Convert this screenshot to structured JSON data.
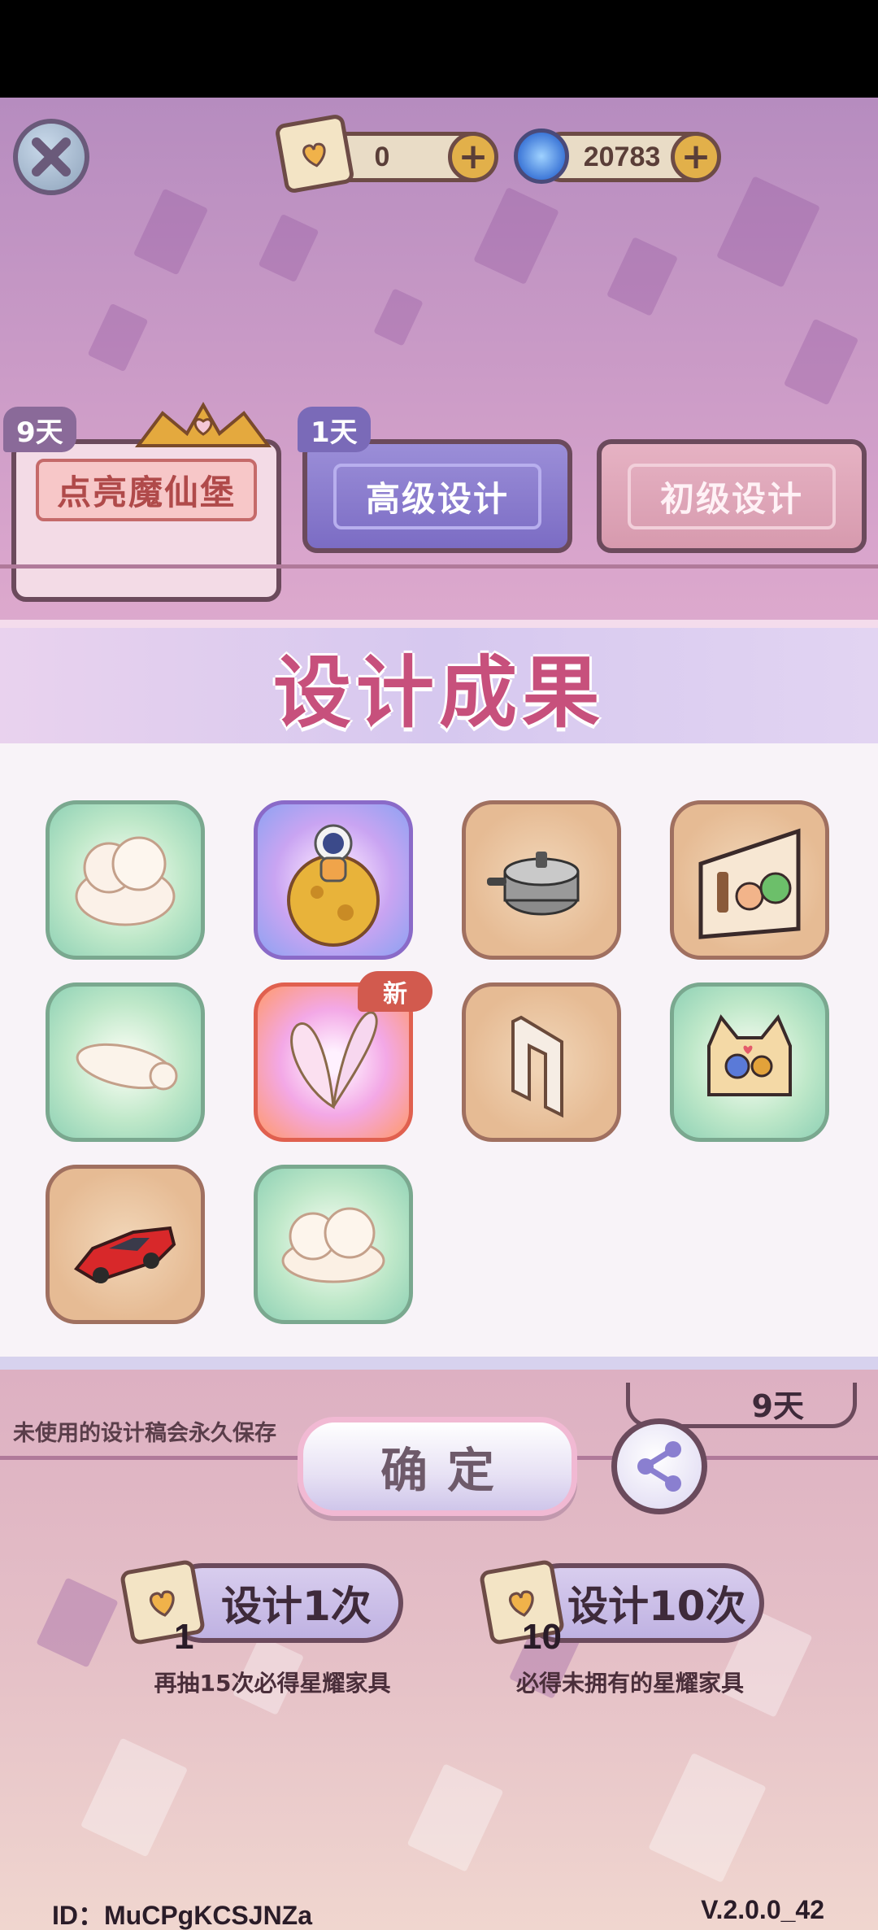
{
  "currencies": {
    "scroll_value": "0",
    "gem_value": "20783",
    "plus_label": "+"
  },
  "tabs": [
    {
      "label": "点亮魔仙堡",
      "days": "9天"
    },
    {
      "label": "高级设计",
      "days": "1天"
    },
    {
      "label": "初级设计"
    }
  ],
  "result_panel": {
    "title": "设计成果",
    "new_badge": "新"
  },
  "notice": "未使用的设计稿会永久保存",
  "confirm_label": "确定",
  "draw": {
    "single": {
      "label": "设计1次",
      "count": "1",
      "sub": "再抽15次必得星耀家具"
    },
    "ten": {
      "label": "设计10次",
      "count": "10",
      "sub": "必得未拥有的星耀家具"
    }
  },
  "behind_timer": "9天",
  "footer": {
    "id": "ID：MuCPgKCSJNZa",
    "version": "V.2.0.0_42"
  },
  "items": [
    {
      "name": "cloud-sofa",
      "rarity": "green"
    },
    {
      "name": "astronaut-moon",
      "rarity": "purple"
    },
    {
      "name": "pressure-cooker",
      "rarity": "tan"
    },
    {
      "name": "potion-shelf",
      "rarity": "tan"
    },
    {
      "name": "cat-pillow",
      "rarity": "green"
    },
    {
      "name": "butterfly-wings",
      "rarity": "rainbow"
    },
    {
      "name": "white-arch",
      "rarity": "tan"
    },
    {
      "name": "cat-ear-bag",
      "rarity": "green"
    },
    {
      "name": "red-sports-car",
      "rarity": "tan"
    },
    {
      "name": "cloud-bench",
      "rarity": "green"
    }
  ]
}
